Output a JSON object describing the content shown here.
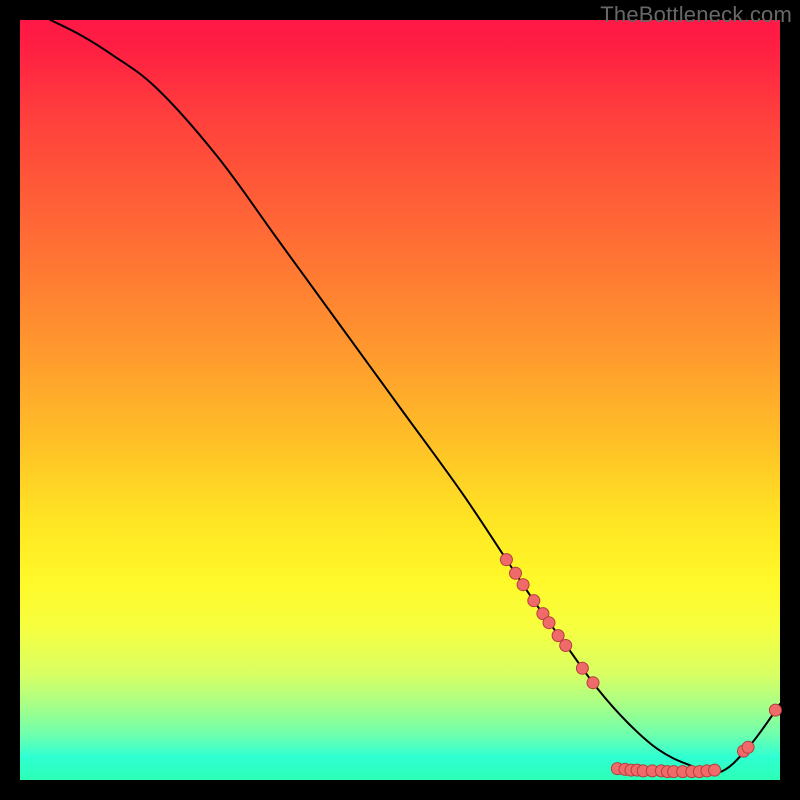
{
  "watermark": "TheBottleneck.com",
  "colors": {
    "curve_stroke": "#000000",
    "dot_fill": "#f16a6a",
    "dot_stroke": "#b33e3e",
    "bg": "#000000"
  },
  "chart_data": {
    "type": "line",
    "title": "",
    "xlabel": "",
    "ylabel": "",
    "xlim": [
      0,
      100
    ],
    "ylim": [
      0,
      100
    ],
    "grid": false,
    "legend": false,
    "series": [
      {
        "name": "curve",
        "x": [
          4,
          8,
          12,
          18,
          26,
          34,
          42,
          50,
          58,
          64,
          68,
          72,
          76,
          80,
          84,
          88,
          92,
          96,
          100
        ],
        "y": [
          100,
          98,
          95.5,
          91,
          82,
          71,
          60,
          49,
          38,
          29,
          23,
          17.5,
          12,
          7.5,
          4,
          2,
          1,
          4.5,
          10
        ]
      }
    ],
    "points": [
      {
        "x": 64.0,
        "y": 29.0
      },
      {
        "x": 65.2,
        "y": 27.2
      },
      {
        "x": 66.2,
        "y": 25.7
      },
      {
        "x": 67.6,
        "y": 23.6
      },
      {
        "x": 68.8,
        "y": 21.9
      },
      {
        "x": 69.6,
        "y": 20.7
      },
      {
        "x": 70.8,
        "y": 19.0
      },
      {
        "x": 71.8,
        "y": 17.7
      },
      {
        "x": 74.0,
        "y": 14.7
      },
      {
        "x": 75.4,
        "y": 12.8
      },
      {
        "x": 78.6,
        "y": 1.5
      },
      {
        "x": 79.6,
        "y": 1.4
      },
      {
        "x": 80.4,
        "y": 1.3
      },
      {
        "x": 81.2,
        "y": 1.3
      },
      {
        "x": 82.0,
        "y": 1.2
      },
      {
        "x": 83.2,
        "y": 1.2
      },
      {
        "x": 84.4,
        "y": 1.2
      },
      {
        "x": 85.2,
        "y": 1.1
      },
      {
        "x": 86.0,
        "y": 1.1
      },
      {
        "x": 87.2,
        "y": 1.1
      },
      {
        "x": 88.4,
        "y": 1.1
      },
      {
        "x": 89.4,
        "y": 1.1
      },
      {
        "x": 90.4,
        "y": 1.2
      },
      {
        "x": 91.4,
        "y": 1.3
      },
      {
        "x": 95.2,
        "y": 3.8
      },
      {
        "x": 95.8,
        "y": 4.3
      },
      {
        "x": 99.4,
        "y": 9.2
      }
    ]
  }
}
